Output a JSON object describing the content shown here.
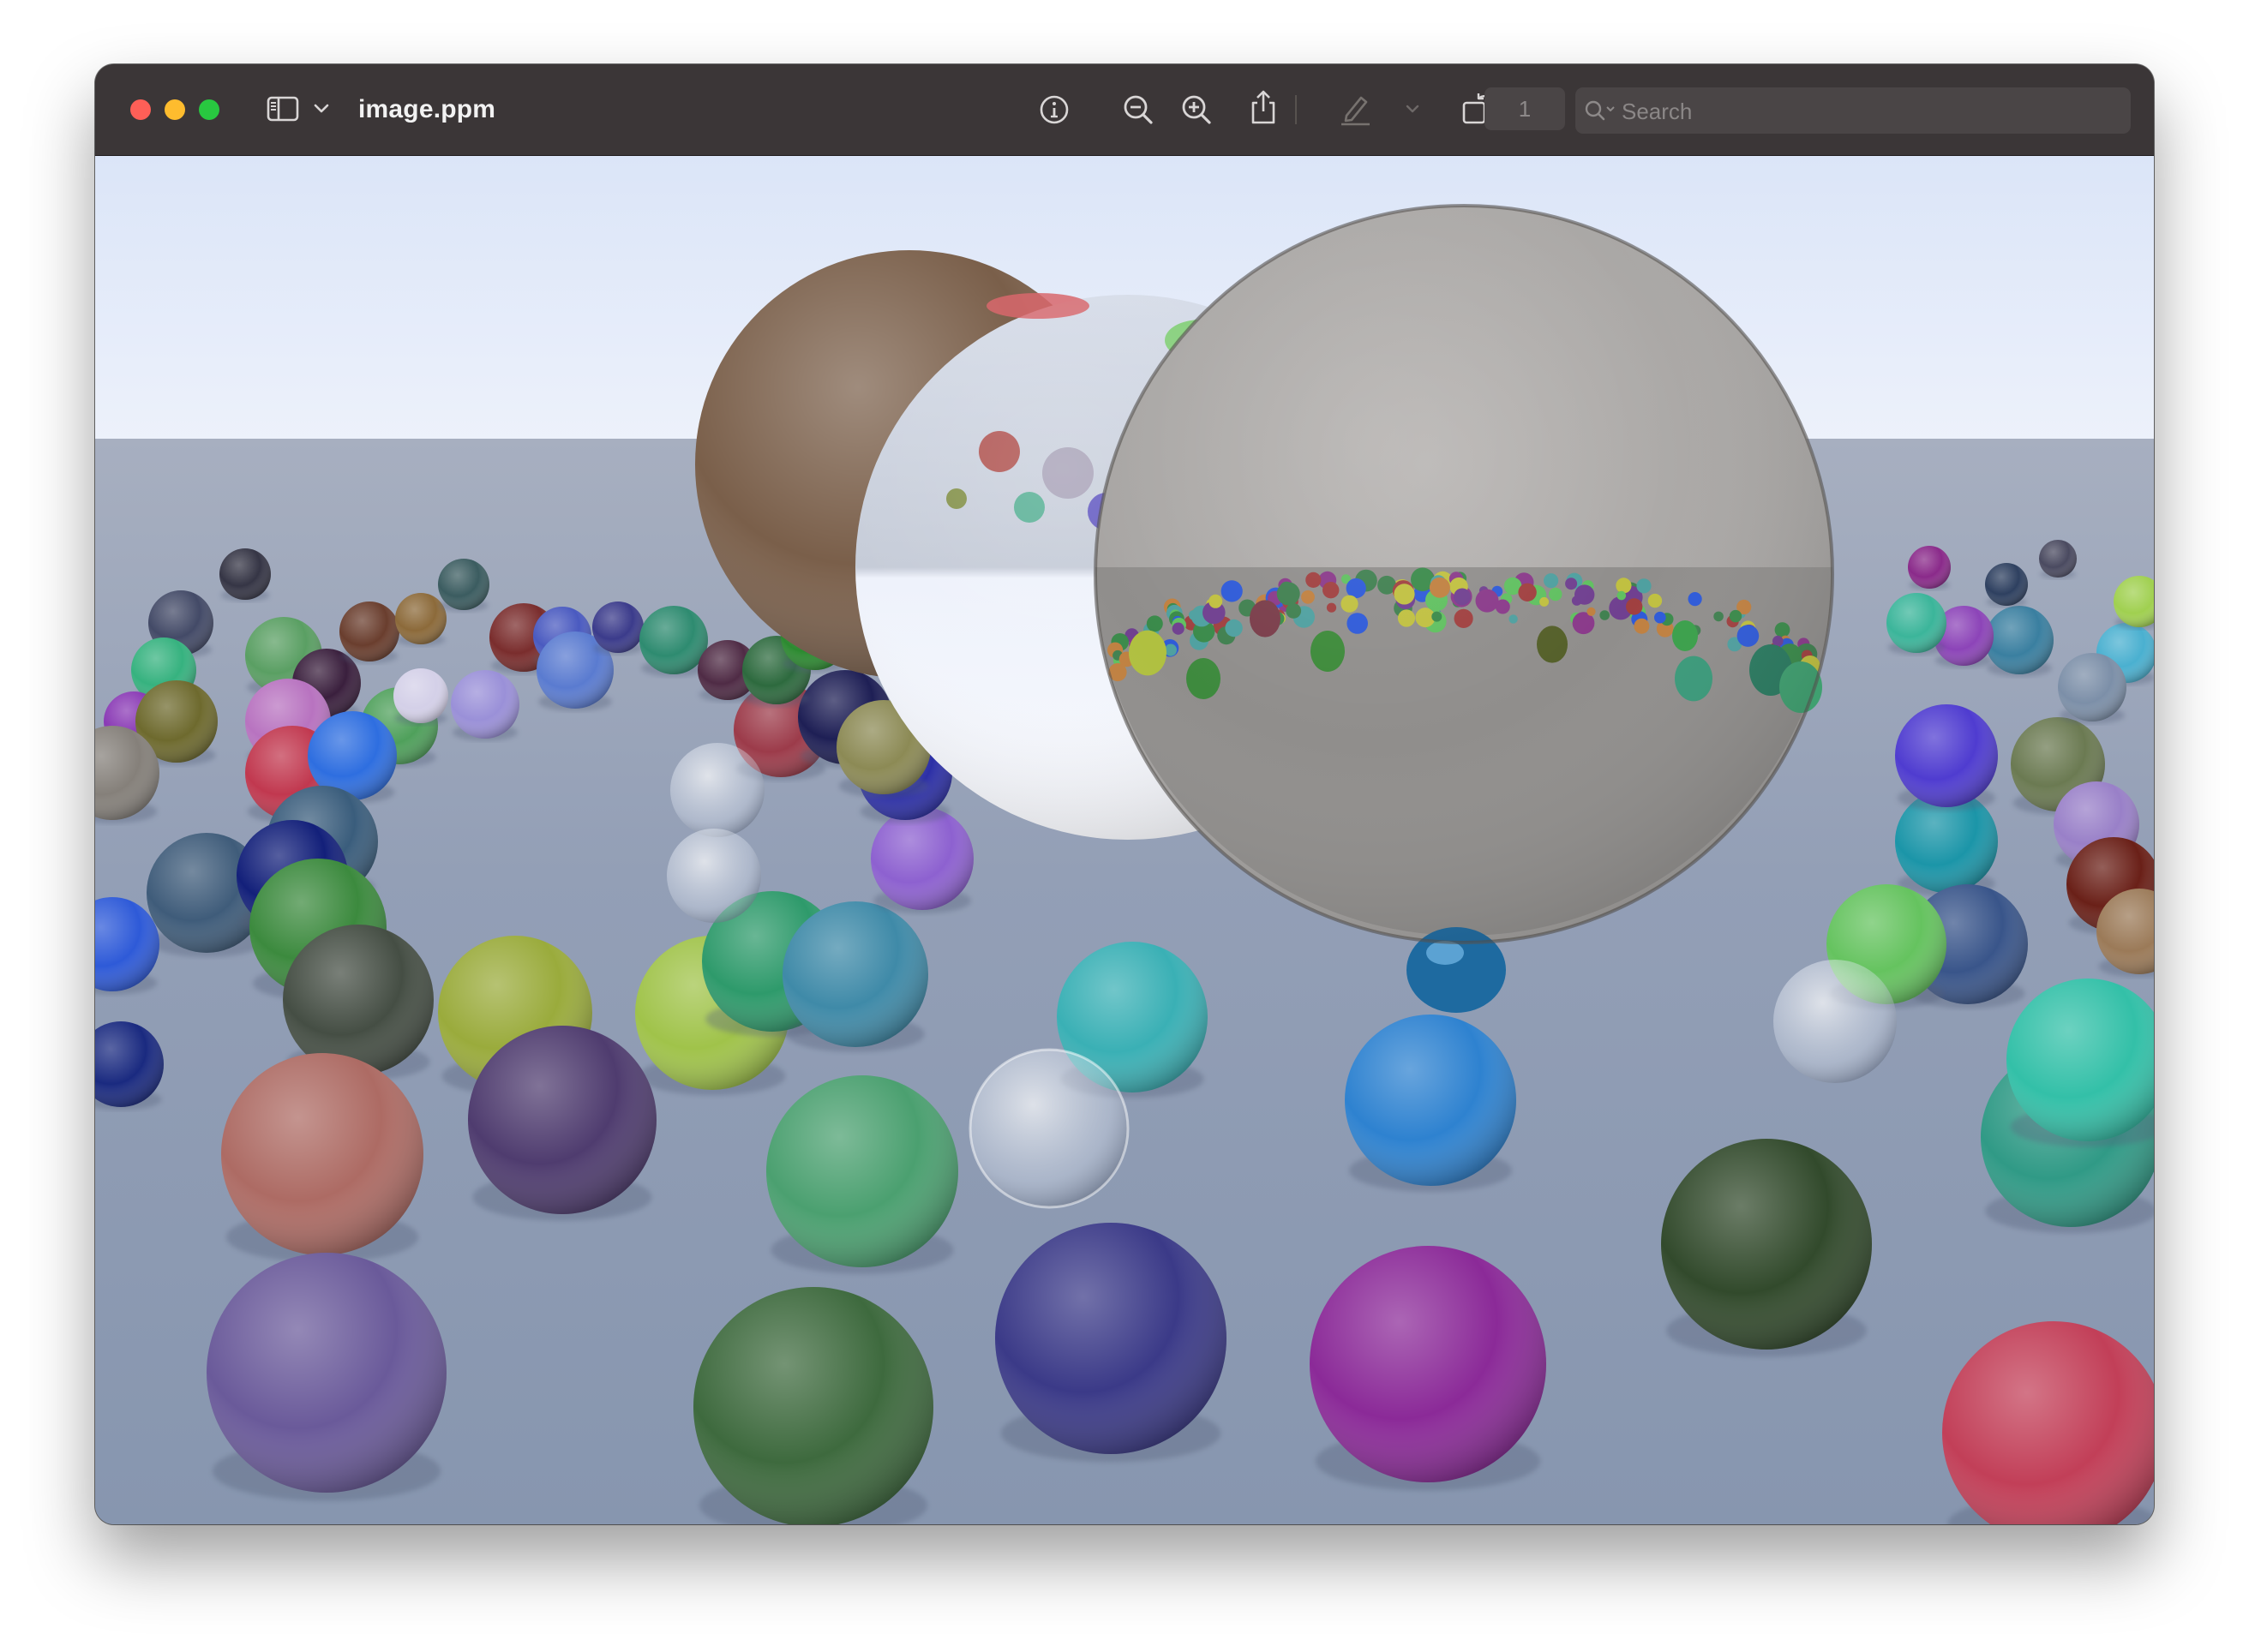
{
  "window": {
    "title": "image.ppm",
    "toolbar": {
      "page_number": "1",
      "search_placeholder": "Search"
    }
  },
  "icons": {
    "close": "close-button",
    "minimize": "minimize-button",
    "zoom": "zoom-button",
    "sidebar": "sidebar-icon",
    "sidebar_menu": "chevron-down-icon",
    "info": "info-icon",
    "zoom_out": "zoom-out-icon",
    "zoom_in": "zoom-in-icon",
    "share": "share-icon",
    "highlight": "highlighter-icon",
    "highlight_menu": "chevron-down-icon",
    "rotate": "rotate-icon",
    "markup": "markup-icon",
    "search": "search-icon"
  },
  "colors": {
    "titlebar": "#3b3637",
    "close": "#fe5f57",
    "minimize": "#febc2e",
    "zoom": "#28c840",
    "sky_top": "#dde6f7",
    "ground": "#8e9cb4"
  }
}
